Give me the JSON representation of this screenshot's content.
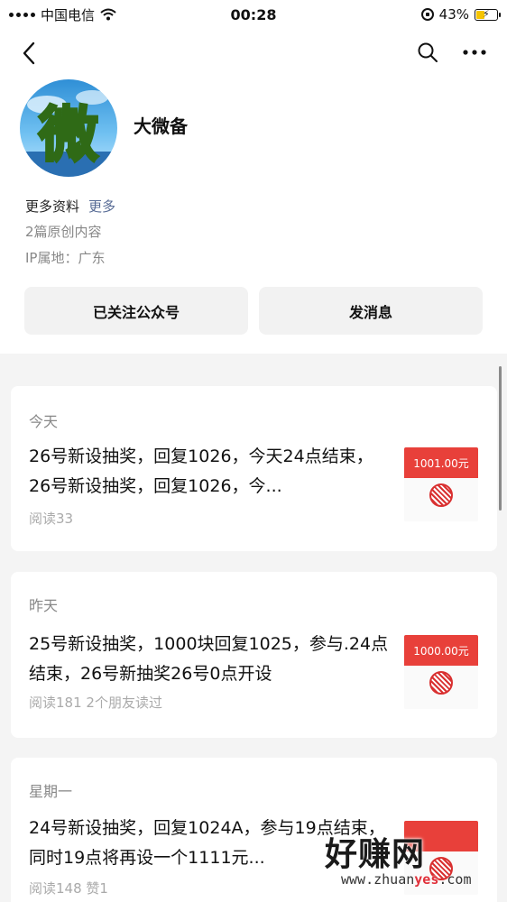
{
  "status_bar": {
    "carrier": "中国电信",
    "time": "00:28",
    "battery": "43%",
    "battery_level": 0.43
  },
  "nav": {
    "back_icon": "chevron-left-icon",
    "search_icon": "search-icon",
    "more_icon": "more-horizontal-icon"
  },
  "profile": {
    "name": "大微备",
    "avatar_glyph": "微",
    "more_info_label": "更多资料",
    "more_link": "更多",
    "original_count": "2篇原创内容",
    "ip_location": "IP属地：广东"
  },
  "buttons": {
    "follow_label": "已关注公众号",
    "message_label": "发消息"
  },
  "articles": [
    {
      "date": "今天",
      "text": "26号新设抽奖，回复1026，今天24点结束，26号新设抽奖，回复1026，今...",
      "meta": "阅读33",
      "thumb_label": "1001.00元"
    },
    {
      "date": "昨天",
      "text": "25号新设抽奖，1000块回复1025，参与.24点结束，26号新抽奖26号0点开设",
      "meta": "阅读181  2个朋友读过",
      "thumb_label": "1000.00元"
    },
    {
      "date": "星期一",
      "text": "24号新设抽奖，回复1024A，参与19点结束，同时19点将再设一个1111元...",
      "meta": "阅读148  赞1",
      "thumb_label": ""
    }
  ],
  "watermark": {
    "title": "好赚网",
    "url_prefix": "www.zhuan",
    "url_highlight": "yes",
    "url_suffix": ".com"
  }
}
